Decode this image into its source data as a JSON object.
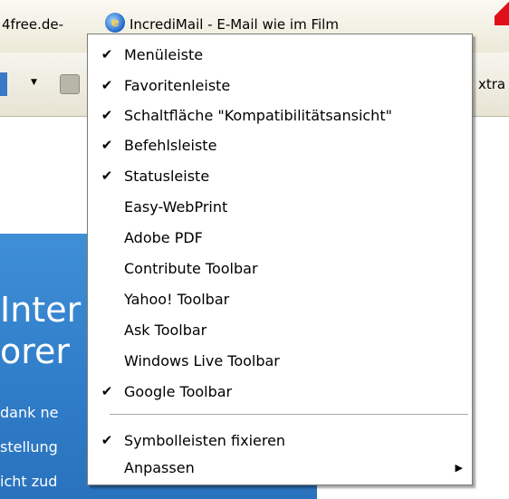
{
  "favorites_bar": {
    "left_link": "4free.de-",
    "link_title": "IncrediMail - E-Mail wie im Film",
    "right_text": "xtra"
  },
  "page": {
    "heading_line1": "Inter",
    "heading_line2": "orer",
    "body_line1": "dank ne",
    "body_line2": "stellung",
    "body_line3": "icht zud"
  },
  "context_menu": {
    "items": [
      {
        "label": "Menüleiste",
        "checked": true
      },
      {
        "label": "Favoritenleiste",
        "checked": true
      },
      {
        "label": "Schaltfläche \"Kompatibilitätsansicht\"",
        "checked": true
      },
      {
        "label": "Befehlsleiste",
        "checked": true
      },
      {
        "label": "Statusleiste",
        "checked": true
      },
      {
        "label": "Easy-WebPrint",
        "checked": false
      },
      {
        "label": "Adobe PDF",
        "checked": false
      },
      {
        "label": "Contribute Toolbar",
        "checked": false
      },
      {
        "label": "Yahoo! Toolbar",
        "checked": false
      },
      {
        "label": "Ask Toolbar",
        "checked": false
      },
      {
        "label": "Windows Live Toolbar",
        "checked": false
      },
      {
        "label": "Google Toolbar",
        "checked": true
      },
      {
        "label": "Symbolleisten fixieren",
        "checked": true
      },
      {
        "label": "Anpassen",
        "checked": false,
        "submenu": true
      }
    ],
    "check_glyph": "✔",
    "submenu_glyph": "▶"
  },
  "colors": {
    "panel_blue": "#2f7cc8",
    "menu_border": "#7a7a7a",
    "arrow_red": "#e0101a"
  }
}
